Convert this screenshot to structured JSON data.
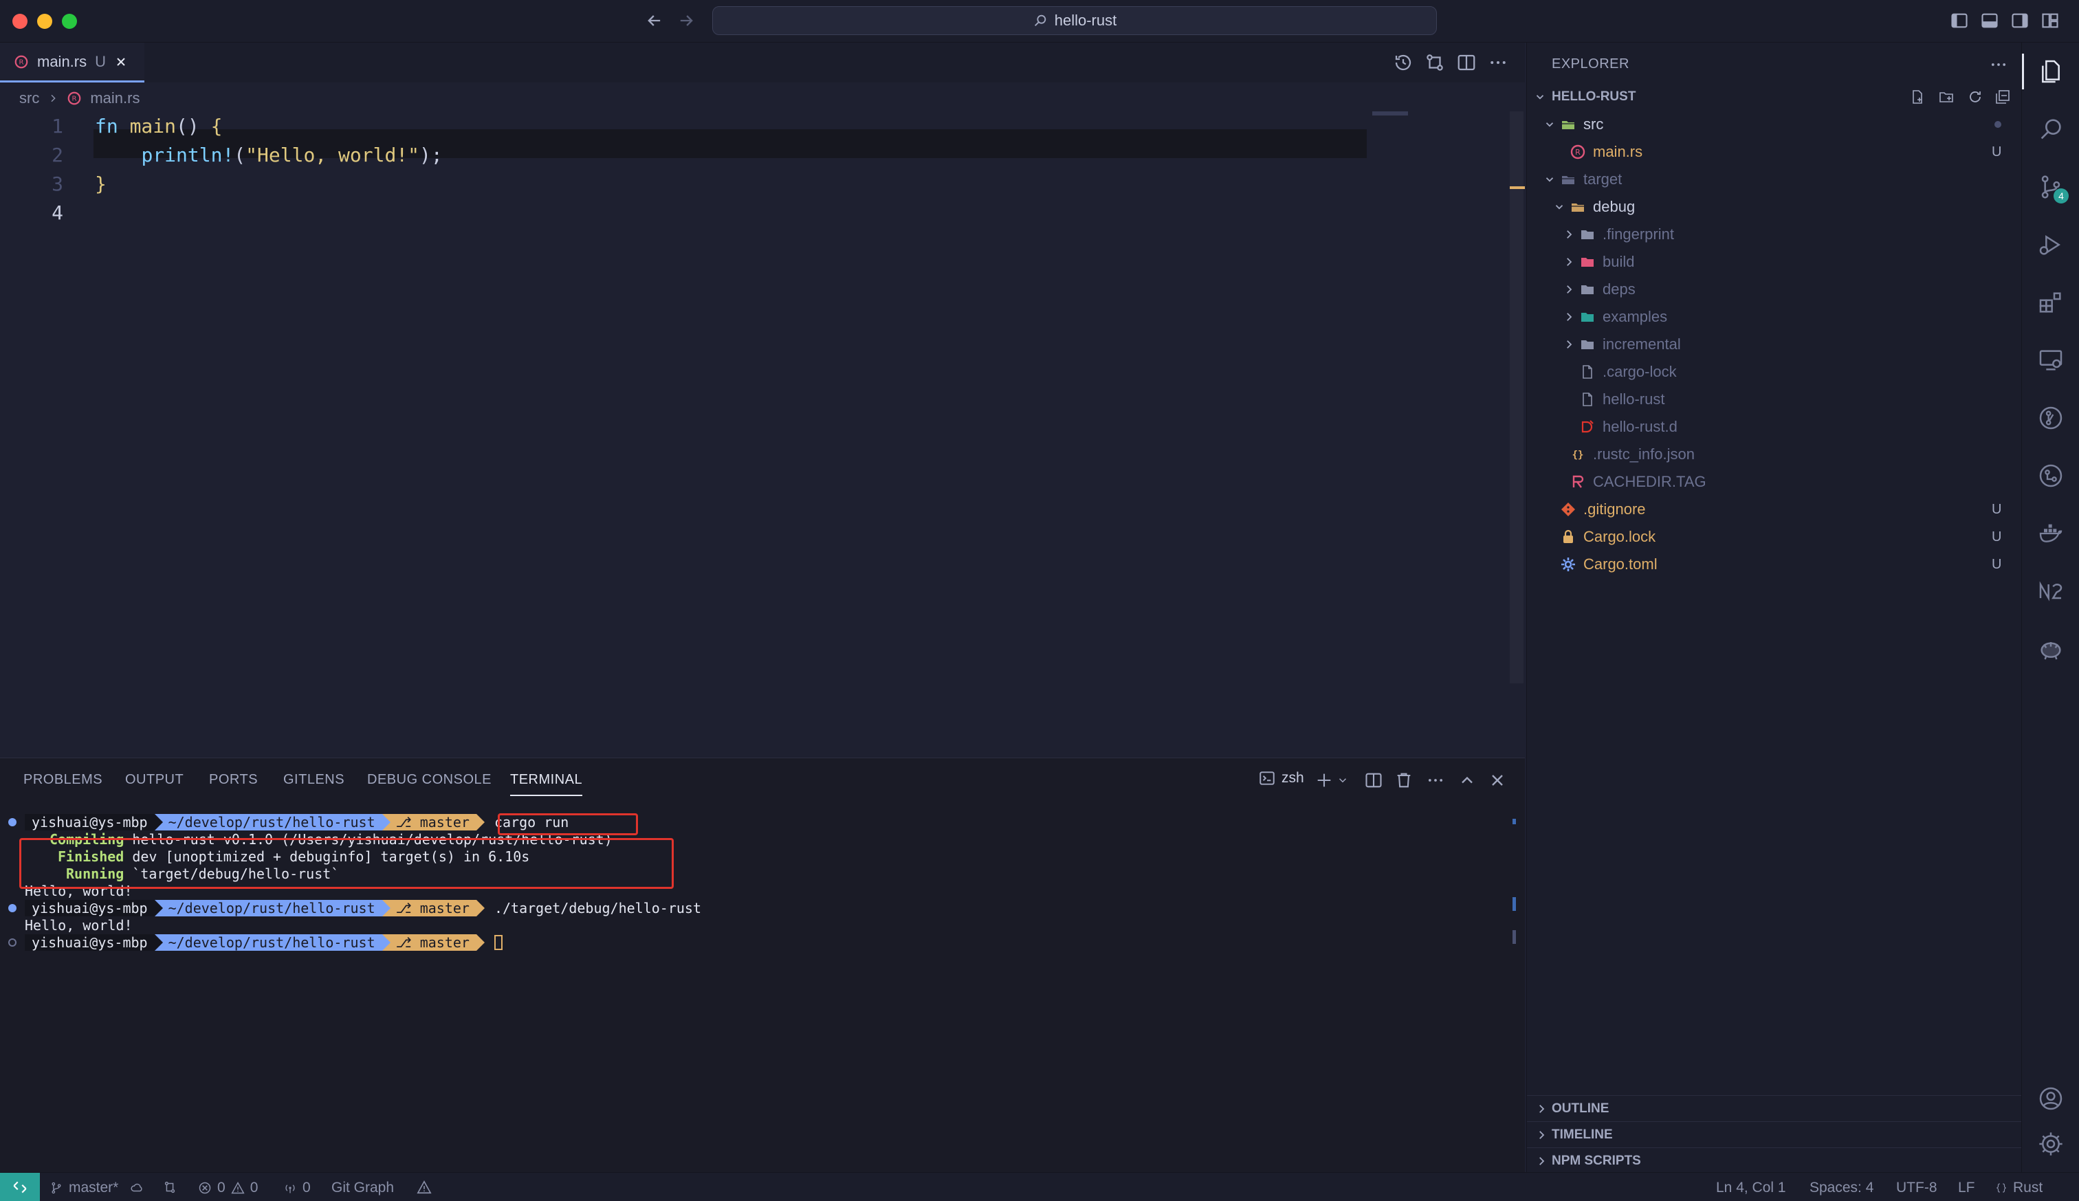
{
  "window": {
    "search_text": "hello-rust"
  },
  "editor": {
    "tab": {
      "name": "main.rs",
      "status": "U"
    },
    "breadcrumb": [
      "src",
      "main.rs"
    ],
    "lines": [
      {
        "n": "1",
        "tokens": [
          [
            "kw",
            "fn "
          ],
          [
            "fn",
            "main"
          ],
          [
            "pun",
            "() "
          ],
          [
            "brace",
            "{"
          ]
        ]
      },
      {
        "n": "2",
        "tokens": [
          [
            "pun",
            "    "
          ],
          [
            "mac",
            "println!"
          ],
          [
            "pun",
            "("
          ],
          [
            "str",
            "\"Hello, world!\""
          ],
          [
            "pun",
            ");"
          ]
        ]
      },
      {
        "n": "3",
        "tokens": [
          [
            "brace",
            "}"
          ]
        ]
      },
      {
        "n": "4",
        "tokens": []
      }
    ]
  },
  "panel": {
    "tabs": [
      "PROBLEMS",
      "OUTPUT",
      "PORTS",
      "GITLENS",
      "DEBUG CONSOLE",
      "TERMINAL"
    ],
    "active_tab": "TERMINAL",
    "shell": "zsh",
    "prompt": {
      "user": "yishuai@ys-mbp",
      "path": "~/develop/rust/hello-rust",
      "branch": "master"
    },
    "terminal": {
      "cmd1": "cargo run",
      "compiling_label": "Compiling",
      "compiling_text": "hello-rust v0.1.0 (/Users/yishuai/develop/rust/hello-rust)",
      "finished_label": "Finished",
      "finished_text": "dev [unoptimized + debuginfo] target(s) in 6.10s",
      "running_label": "Running",
      "running_text": "`target/debug/hello-rust`",
      "output1": "Hello, world!",
      "cmd2": "./target/debug/hello-rust",
      "output2": "Hello, world!"
    }
  },
  "explorer": {
    "title": "EXPLORER",
    "root": "HELLO-RUST",
    "tree": [
      {
        "label": "src",
        "level": 1,
        "kind": "folder-open",
        "color": "#9ece6a",
        "labelClass": ""
      },
      {
        "label": "main.rs",
        "level": 2,
        "kind": "rust",
        "labelClass": "git-u",
        "badge": "U"
      },
      {
        "label": "target",
        "level": 1,
        "kind": "folder-open",
        "color": "#6b7190",
        "labelClass": "dim"
      },
      {
        "label": "debug",
        "level": 2,
        "kind": "folder-open",
        "color": "#e0af68",
        "labelClass": ""
      },
      {
        "label": ".fingerprint",
        "level": 3,
        "kind": "folder",
        "color": "#8a90a8",
        "labelClass": "dim"
      },
      {
        "label": "build",
        "level": 3,
        "kind": "folder",
        "color": "#e0567a",
        "labelClass": "dim"
      },
      {
        "label": "deps",
        "level": 3,
        "kind": "folder",
        "color": "#8a90a8",
        "labelClass": "dim"
      },
      {
        "label": "examples",
        "level": 3,
        "kind": "folder",
        "color": "#2aa198",
        "labelClass": "dim"
      },
      {
        "label": "incremental",
        "level": 3,
        "kind": "folder",
        "color": "#8a90a8",
        "labelClass": "dim"
      },
      {
        "label": ".cargo-lock",
        "level": 3,
        "kind": "file",
        "labelClass": "dim"
      },
      {
        "label": "hello-rust",
        "level": 3,
        "kind": "file",
        "labelClass": "dim"
      },
      {
        "label": "hello-rust.d",
        "level": 3,
        "kind": "file-d",
        "labelClass": "dim"
      },
      {
        "label": ".rustc_info.json",
        "level": 2,
        "kind": "json",
        "labelClass": "dim"
      },
      {
        "label": "CACHEDIR.TAG",
        "level": 2,
        "kind": "tag",
        "labelClass": "dim"
      },
      {
        "label": ".gitignore",
        "level": 1,
        "kind": "git",
        "labelClass": "git-u",
        "badge": "U"
      },
      {
        "label": "Cargo.lock",
        "level": 1,
        "kind": "lock",
        "labelClass": "git-u",
        "badge": "U"
      },
      {
        "label": "Cargo.toml",
        "level": 1,
        "kind": "gear",
        "labelClass": "git-u",
        "badge": "U"
      }
    ],
    "sections": [
      "OUTLINE",
      "TIMELINE",
      "NPM SCRIPTS"
    ]
  },
  "activity": {
    "scm_badge": "4"
  },
  "status": {
    "branch": "master*",
    "errors": "0",
    "warnings": "0",
    "ports": "0",
    "git_graph": "Git Graph",
    "position": "Ln 4, Col 1",
    "spaces": "Spaces: 4",
    "encoding": "UTF-8",
    "eol": "LF",
    "language": "Rust"
  },
  "colors": {
    "accent": "#7aa2f7",
    "git_branch": "#e0af68",
    "remote": "#2aa198",
    "highlight_box": "#e0342c"
  }
}
